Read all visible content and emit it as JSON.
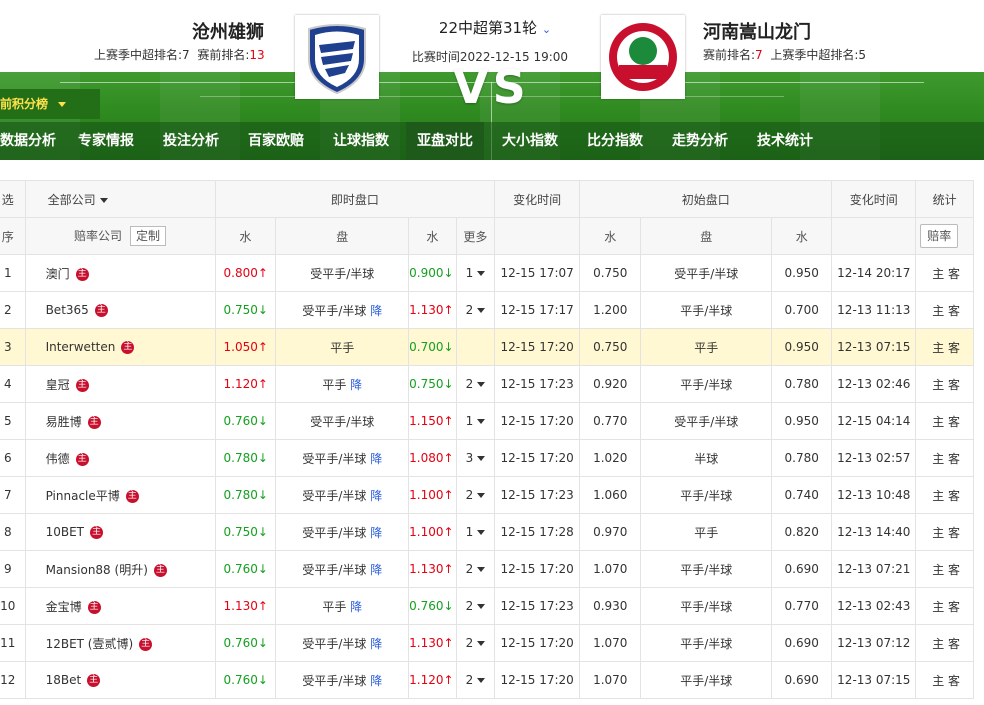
{
  "header": {
    "home": {
      "name": "沧州雄狮",
      "last_season_label": "上赛季中超排名:",
      "last_season_rank": "7",
      "pre_rank_label": "赛前排名:",
      "pre_rank": "13"
    },
    "away": {
      "name": "河南嵩山龙门",
      "pre_rank_label": "赛前排名:",
      "pre_rank": "7",
      "last_season_label": "上赛季中超排名:",
      "last_season_rank": "5"
    },
    "round": "22中超第31轮",
    "match_time": "比赛时间2022-12-15 19:00",
    "vs": "VS",
    "points_tab": "赛前积分榜"
  },
  "nav": [
    "数据分析",
    "专家情报",
    "投注分析",
    "百家欧赔",
    "让球指数",
    "亚盘对比",
    "大小指数",
    "比分指数",
    "走势分析",
    "技术统计"
  ],
  "nav_active": "亚盘对比",
  "table": {
    "h1": {
      "sel": "选",
      "company": "全部公司",
      "live": "即时盘口",
      "change_time": "变化时间",
      "initial": "初始盘口",
      "change_time2": "变化时间",
      "stats": "统计"
    },
    "h2": {
      "no": "序",
      "company": "赔率公司",
      "custom": "定制",
      "water": "水",
      "handicap": "盘",
      "water2": "水",
      "more": "更多",
      "stats_btn": "赔率"
    },
    "zhu": "主",
    "drop": "降",
    "home_away": "主 客",
    "rows": [
      {
        "no": "1",
        "company": "澳门",
        "lw1": "0.800",
        "lw1d": "up",
        "lh": "受平手/半球",
        "ldrop": false,
        "lw2": "0.900",
        "lw2d": "down",
        "more": "1",
        "time": "12-15 17:07",
        "iw1": "0.750",
        "ih": "受平手/半球",
        "iw2": "0.950",
        "itime": "12-14 20:17"
      },
      {
        "no": "2",
        "company": "Bet365",
        "lw1": "0.750",
        "lw1d": "down",
        "lh": "受平手/半球",
        "ldrop": true,
        "lw2": "1.130",
        "lw2d": "up",
        "more": "2",
        "time": "12-15 17:17",
        "iw1": "1.200",
        "ih": "平手/半球",
        "iw2": "0.700",
        "itime": "12-13 11:13"
      },
      {
        "no": "3",
        "company": "Interwetten",
        "lw1": "1.050",
        "lw1d": "up",
        "lh": "平手",
        "ldrop": false,
        "lw2": "0.700",
        "lw2d": "down",
        "more": "",
        "time": "12-15 17:20",
        "iw1": "0.750",
        "ih": "平手",
        "iw2": "0.950",
        "itime": "12-13 07:15",
        "hl": true
      },
      {
        "no": "4",
        "company": "皇冠",
        "lw1": "1.120",
        "lw1d": "up",
        "lh": "平手",
        "ldrop": true,
        "lw2": "0.750",
        "lw2d": "down",
        "more": "2",
        "time": "12-15 17:23",
        "iw1": "0.920",
        "ih": "平手/半球",
        "iw2": "0.780",
        "itime": "12-13 02:46"
      },
      {
        "no": "5",
        "company": "易胜博",
        "lw1": "0.760",
        "lw1d": "down",
        "lh": "受平手/半球",
        "ldrop": false,
        "lw2": "1.150",
        "lw2d": "up",
        "more": "1",
        "time": "12-15 17:20",
        "iw1": "0.770",
        "ih": "受平手/半球",
        "iw2": "0.950",
        "itime": "12-15 04:14"
      },
      {
        "no": "6",
        "company": "伟德",
        "lw1": "0.780",
        "lw1d": "down",
        "lh": "受平手/半球",
        "ldrop": true,
        "lw2": "1.080",
        "lw2d": "up",
        "more": "3",
        "time": "12-15 17:20",
        "iw1": "1.020",
        "ih": "半球",
        "iw2": "0.780",
        "itime": "12-13 02:57"
      },
      {
        "no": "7",
        "company": "Pinnacle平博",
        "lw1": "0.780",
        "lw1d": "down",
        "lh": "受平手/半球",
        "ldrop": true,
        "lw2": "1.100",
        "lw2d": "up",
        "more": "2",
        "time": "12-15 17:23",
        "iw1": "1.060",
        "ih": "平手/半球",
        "iw2": "0.740",
        "itime": "12-13 10:48"
      },
      {
        "no": "8",
        "company": "10BET",
        "lw1": "0.750",
        "lw1d": "down",
        "lh": "受平手/半球",
        "ldrop": true,
        "lw2": "1.100",
        "lw2d": "up",
        "more": "1",
        "time": "12-15 17:28",
        "iw1": "0.970",
        "ih": "平手",
        "iw2": "0.820",
        "itime": "12-13 14:40"
      },
      {
        "no": "9",
        "company": "Mansion88 (明升)",
        "lw1": "0.760",
        "lw1d": "down",
        "lh": "受平手/半球",
        "ldrop": true,
        "lw2": "1.130",
        "lw2d": "up",
        "more": "2",
        "time": "12-15 17:20",
        "iw1": "1.070",
        "ih": "平手/半球",
        "iw2": "0.690",
        "itime": "12-13 07:21"
      },
      {
        "no": "10",
        "company": "金宝博",
        "lw1": "1.130",
        "lw1d": "up",
        "lh": "平手",
        "ldrop": true,
        "lw2": "0.760",
        "lw2d": "down",
        "more": "2",
        "time": "12-15 17:23",
        "iw1": "0.930",
        "ih": "平手/半球",
        "iw2": "0.770",
        "itime": "12-13 02:43"
      },
      {
        "no": "11",
        "company": "12BET (壹贰博)",
        "lw1": "0.760",
        "lw1d": "down",
        "lh": "受平手/半球",
        "ldrop": true,
        "lw2": "1.130",
        "lw2d": "up",
        "more": "2",
        "time": "12-15 17:20",
        "iw1": "1.070",
        "ih": "平手/半球",
        "iw2": "0.690",
        "itime": "12-13 07:12"
      },
      {
        "no": "12",
        "company": "18Bet",
        "lw1": "0.760",
        "lw1d": "down",
        "lh": "受平手/半球",
        "ldrop": true,
        "lw2": "1.120",
        "lw2d": "up",
        "more": "2",
        "time": "12-15 17:20",
        "iw1": "1.070",
        "ih": "平手/半球",
        "iw2": "0.690",
        "itime": "12-13 07:15"
      }
    ]
  },
  "colors": {
    "up": "#e60012",
    "down": "#14a020",
    "highlight": "#fff8d2",
    "pitch": "#2f8a20",
    "drop": "#2b5fd9"
  }
}
